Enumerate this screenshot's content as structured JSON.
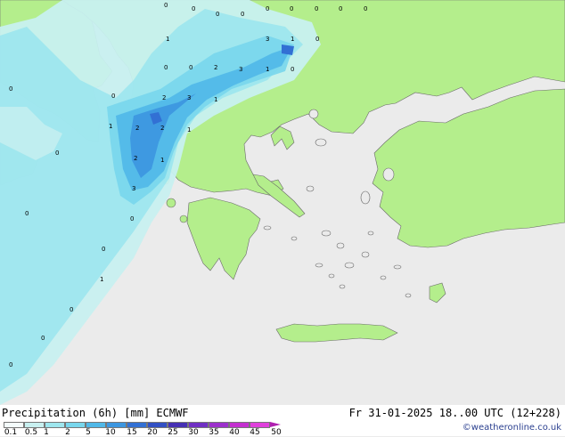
{
  "map": {
    "precip_values": [
      "0",
      "0",
      "0",
      "0",
      "0",
      "0",
      "0",
      "0",
      "1",
      "3",
      "1",
      "0",
      "0",
      "0",
      "2",
      "3",
      "1",
      "0",
      "0",
      "0",
      "2",
      "3",
      "1",
      "1",
      "2",
      "2",
      "1",
      "0",
      "2",
      "1",
      "3",
      "0",
      "0",
      "0",
      "1",
      "0",
      "0",
      "0",
      "0"
    ]
  },
  "footer": {
    "title": "Precipitation (6h) [mm] ECMWF",
    "valid_time": "Fr 31-01-2025 18..00 UTC (12+228)",
    "credit": "©weatheronline.co.uk"
  },
  "scale": {
    "colors": [
      "#f4fcfc",
      "#c8f0f0",
      "#9ee6ee",
      "#78d6ec",
      "#50b8e8",
      "#3c96e0",
      "#3270d4",
      "#3250c4",
      "#4630b4",
      "#7030c4",
      "#9c30cc",
      "#c430d0",
      "#e040dc",
      "#b020b0"
    ],
    "tick_labels": [
      "0.1",
      "0.5",
      "1",
      "2",
      "5",
      "10",
      "15",
      "20",
      "25",
      "30",
      "35",
      "40",
      "45",
      "50"
    ]
  },
  "colors": {
    "sea": "#ebebeb",
    "land": "#b4ee8c"
  }
}
